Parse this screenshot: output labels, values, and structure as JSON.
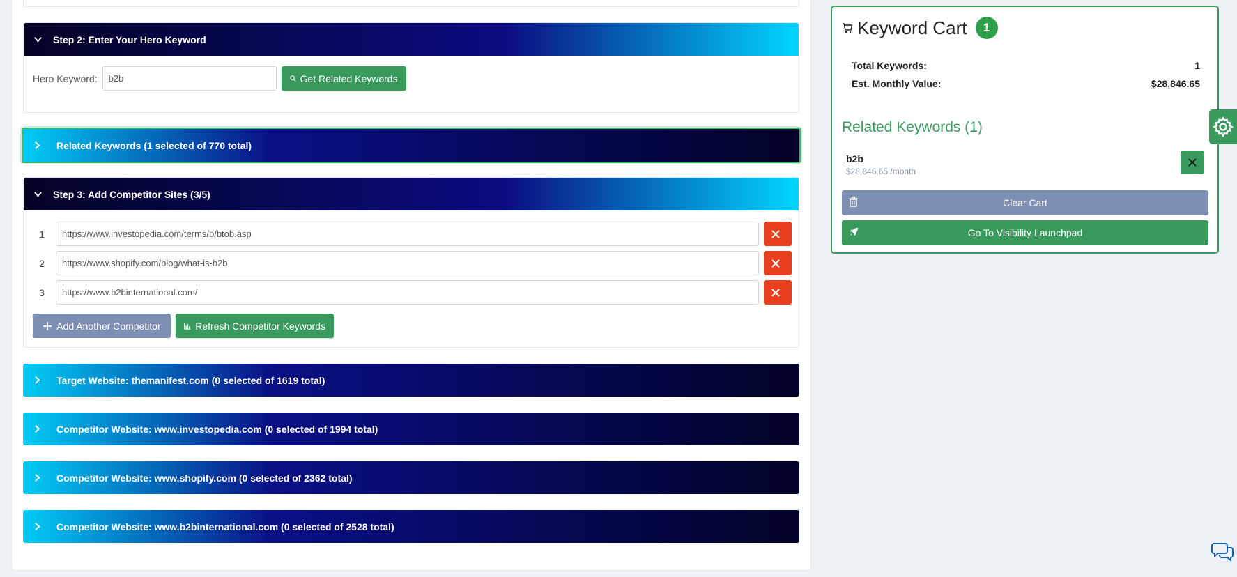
{
  "step2": {
    "header": "Step 2: Enter Your Hero Keyword",
    "hero_label": "Hero Keyword:",
    "hero_value": "b2b",
    "get_related_label": "Get Related Keywords"
  },
  "related": {
    "header": "Related Keywords (1 selected of 770 total)"
  },
  "step3": {
    "header": "Step 3: Add Competitor Sites (3/5)",
    "competitors": [
      {
        "num": "1",
        "url": "https://www.investopedia.com/terms/b/btob.asp"
      },
      {
        "num": "2",
        "url": "https://www.shopify.com/blog/what-is-b2b"
      },
      {
        "num": "3",
        "url": "https://www.b2binternational.com/"
      }
    ],
    "add_label": "Add Another Competitor",
    "refresh_label": "Refresh Competitor Keywords"
  },
  "sites": [
    {
      "label": "Target Website: themanifest.com (0 selected of 1619 total)"
    },
    {
      "label": "Competitor Website: www.investopedia.com (0 selected of 1994 total)"
    },
    {
      "label": "Competitor Website: www.shopify.com (0 selected of 2362 total)"
    },
    {
      "label": "Competitor Website: www.b2binternational.com (0 selected of 2528 total)"
    }
  ],
  "cart": {
    "title": "Keyword Cart",
    "count": "1",
    "total_label": "Total Keywords:",
    "total_value": "1",
    "value_label": "Est. Monthly Value:",
    "value_value": "$28,846.65",
    "related_title": "Related Keywords (1)",
    "items": [
      {
        "name": "b2b",
        "value": "$28,846.65 /month"
      }
    ],
    "clear_label": "Clear Cart",
    "launch_label": "Go To Visibility Launchpad"
  },
  "colors": {
    "accent_green": "#3a9a5e",
    "danger_red": "#e8401f",
    "muted_button": "#7d8fb2",
    "header_navy": "#0b0b80",
    "header_cyan": "#00d5ff"
  },
  "icons": [
    "chevron-down-icon",
    "chevron-right-icon",
    "search-icon",
    "close-icon",
    "plus-icon",
    "bar-chart-icon",
    "cart-icon",
    "trash-icon",
    "rocket-icon",
    "gear-icon",
    "chat-icon"
  ]
}
